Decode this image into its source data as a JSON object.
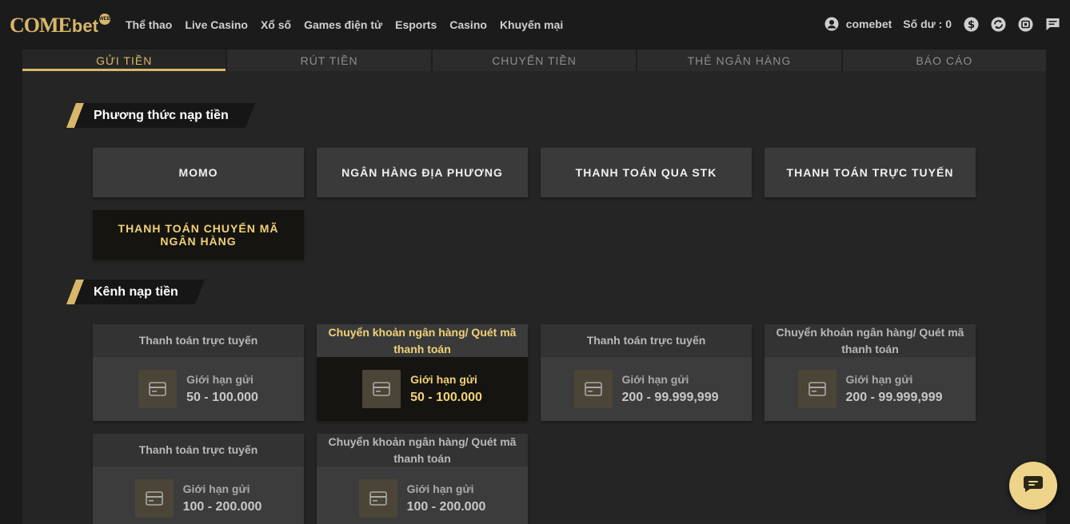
{
  "logo": {
    "come": "COME",
    "bet": "bet",
    "badge": "WEB"
  },
  "nav": [
    "Thể thao",
    "Live Casino",
    "Xổ số",
    "Games điện tử",
    "Esports",
    "Casino",
    "Khuyến mại"
  ],
  "user": {
    "username": "comebet",
    "balance": "Số dư : 0"
  },
  "tabs": [
    "GỬI TIỀN",
    "RÚT TIỀN",
    "CHUYỂN TIỀN",
    "THẺ NGÂN HÀNG",
    "BÁO CÁO"
  ],
  "sections": {
    "methods_title": "Phương thức nạp tiền",
    "channels_title": "Kênh nạp tiền"
  },
  "methods": [
    "MOMO",
    "NGÂN HÀNG ĐỊA PHƯƠNG",
    "THANH TOÁN QUA STK",
    "THANH TOÁN TRỰC TUYẾN",
    "THANH TOÁN CHUYỂN MÃ NGÂN HÀNG"
  ],
  "channels": [
    {
      "title": "Thanh toán trực tuyến",
      "label": "Giới hạn gửi",
      "range": "50 - 100.000"
    },
    {
      "title": "Chuyển khoản ngân hàng/ Quét mã thanh toán",
      "label": "Giới hạn gửi",
      "range": "50 - 100.000"
    },
    {
      "title": "Thanh toán trực tuyến",
      "label": "Giới hạn gửi",
      "range": "200 - 99.999,999"
    },
    {
      "title": "Chuyển khoản ngân hàng/ Quét mã thanh toán",
      "label": "Giới hạn gửi",
      "range": "200 - 99.999,999"
    },
    {
      "title": "Thanh toán trực tuyến",
      "label": "Giới hạn gửi",
      "range": "100 - 200.000"
    },
    {
      "title": "Chuyển khoản ngân hàng/ Quét mã thanh toán",
      "label": "Giới hạn gửi",
      "range": "100 - 200.000"
    }
  ],
  "colors": {
    "accent": "#d8b769",
    "active_text": "#f1d277",
    "background": "#1b1b1b"
  },
  "icons": [
    "user-icon",
    "dollar-icon",
    "refresh-icon",
    "wallet-icon",
    "message-icon",
    "card-icon",
    "chat-icon"
  ]
}
